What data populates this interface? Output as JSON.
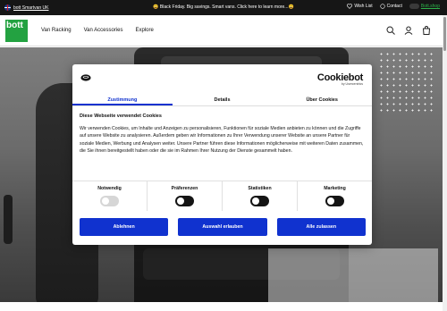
{
  "topbar": {
    "region_label": "bott Smartvan UK",
    "promo": "😄 Black Friday. Big savings. Smart vans. Click here to learn more...😄",
    "wishlist": "Wish List",
    "contact": "Contact",
    "shop": "Bott.shop"
  },
  "header": {
    "logo_text": "bott",
    "nav": [
      "Van Racking",
      "Van Accessories",
      "Explore"
    ]
  },
  "cookie": {
    "brand": "Cookiebot",
    "brand_sub": "by Usercentrics",
    "tabs": [
      "Zustimmung",
      "Details",
      "Über Cookies"
    ],
    "title": "Diese Webseite verwendet Cookies",
    "text": "Wir verwenden Cookies, um Inhalte und Anzeigen zu personalisieren, Funktionen für soziale Medien anbieten zu können und die Zugriffe auf unsere Website zu analysieren. Außerdem geben wir Informationen zu Ihrer Verwendung unserer Website an unsere Partner für soziale Medien, Werbung und Analysen weiter. Unsere Partner führen diese Informationen möglicherweise mit weiteren Daten zusammen, die Sie ihnen bereitgestellt haben oder die sie im Rahmen Ihrer Nutzung der Dienste gesammelt haben.",
    "toggles": [
      "Notwendig",
      "Präferenzen",
      "Statistiken",
      "Marketing"
    ],
    "buttons": [
      "Ablehnen",
      "Auswahl erlauben",
      "Alle zulassen"
    ],
    "accent": "#1032cf"
  }
}
